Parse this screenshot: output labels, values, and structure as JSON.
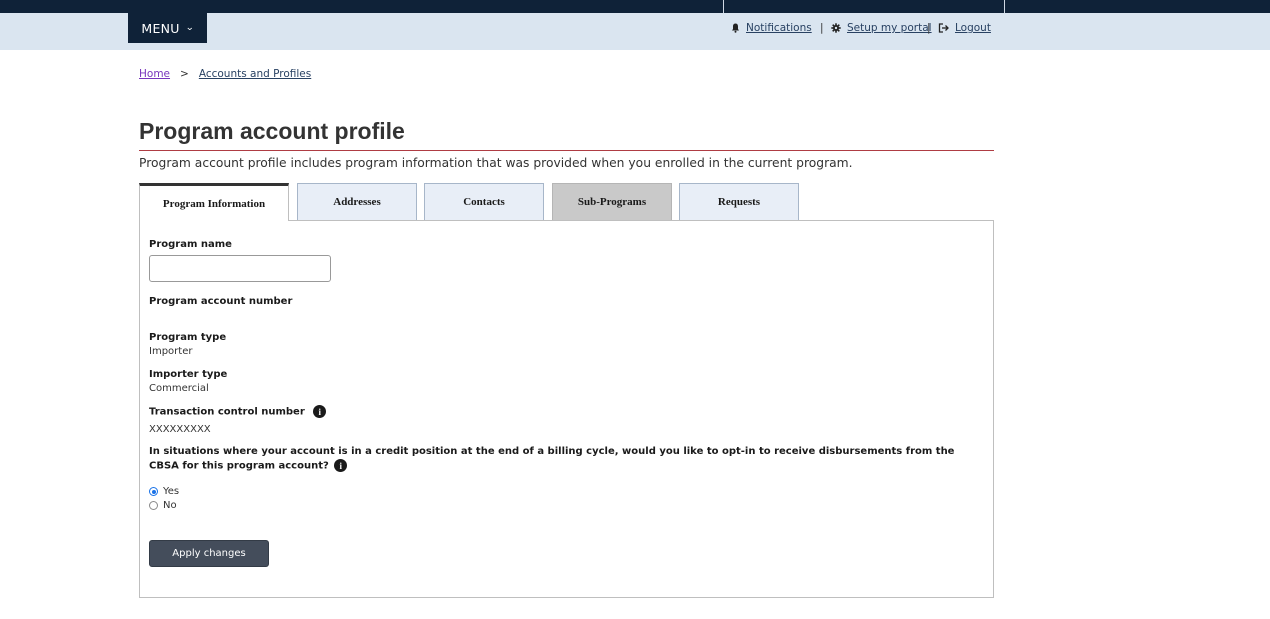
{
  "header": {
    "menu_label": "MENU",
    "notifications_label": "Notifications",
    "setup_label": "Setup my portal",
    "logout_label": "Logout",
    "separator": "|"
  },
  "breadcrumb": {
    "home": "Home",
    "separator": ">",
    "current": "Accounts and Profiles"
  },
  "page": {
    "title": "Program account profile",
    "intro": "Program account profile includes program information that was provided when you enrolled in the current program."
  },
  "tabs": [
    {
      "label": "Program Information",
      "state": "active"
    },
    {
      "label": "Addresses",
      "state": "normal"
    },
    {
      "label": "Contacts",
      "state": "normal"
    },
    {
      "label": "Sub-Programs",
      "state": "disabled"
    },
    {
      "label": "Requests",
      "state": "normal"
    }
  ],
  "form": {
    "program_name_label": "Program name",
    "program_name_value": "",
    "account_number_label": "Program account number",
    "account_number_value": "",
    "program_type_label": "Program type",
    "program_type_value": "Importer",
    "importer_type_label": "Importer type",
    "importer_type_value": "Commercial",
    "tcn_label": "Transaction control number",
    "tcn_value": "XXXXXXXXX",
    "info_glyph": "i",
    "question": "In situations where your account is in a credit position at the end of a billing cycle, would you like to opt-in to receive disbursements from the CBSA for this program account?",
    "options": [
      {
        "label": "Yes",
        "selected": true
      },
      {
        "label": "No",
        "selected": false
      }
    ],
    "apply_label": "Apply changes"
  },
  "colors": {
    "navy": "#0f2238",
    "band": "#dae5f0",
    "title_rule": "#af3c43",
    "link": "#284162",
    "button": "#444d5b"
  },
  "icons": {
    "notifications": "bell-icon",
    "setup": "gear-icon",
    "logout": "logout-icon",
    "menu": "chevron-down-icon",
    "info": "info-icon"
  }
}
